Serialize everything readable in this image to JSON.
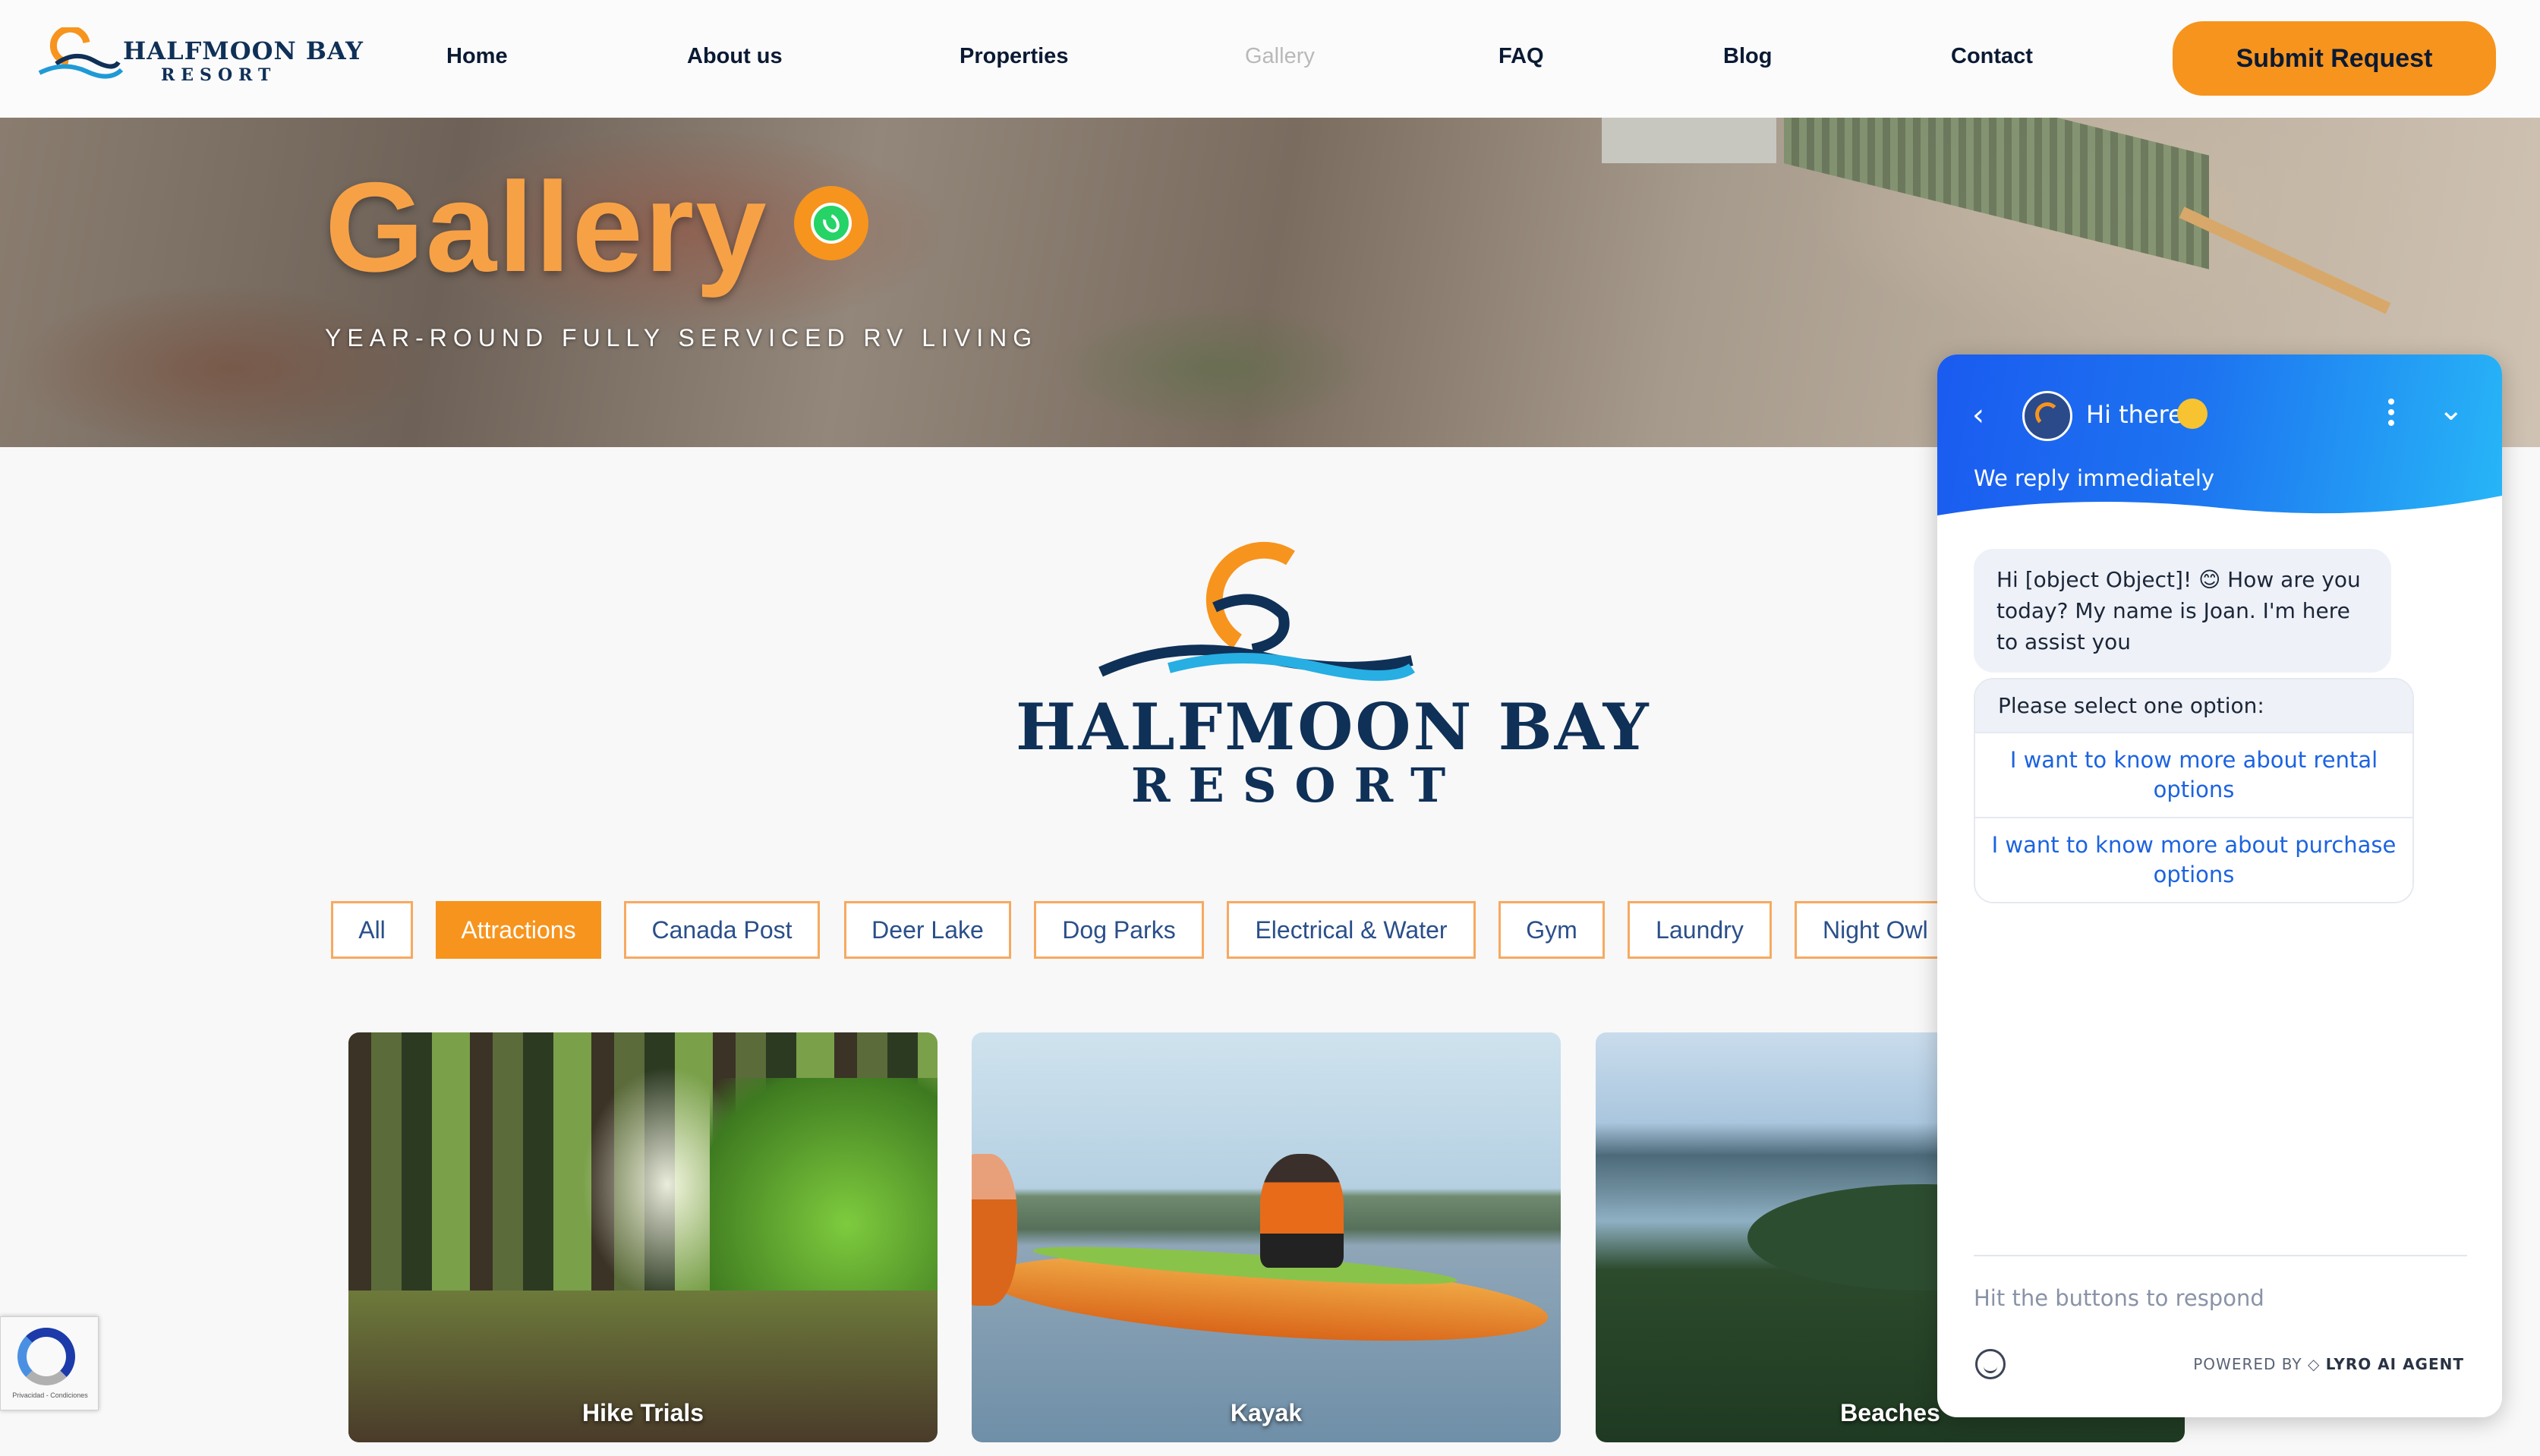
{
  "brand": {
    "name_line1": "HALFMOON BAY",
    "name_line2": "RESORT"
  },
  "nav": {
    "items": [
      "Home",
      "About us",
      "Properties",
      "Gallery",
      "FAQ",
      "Blog",
      "Contact"
    ],
    "active": "Gallery",
    "submit_label": "Submit Request"
  },
  "hero": {
    "title": "Gallery",
    "subtitle": "YEAR-ROUND FULLY SERVICED RV LIVING",
    "icon": "whatsapp-icon"
  },
  "filters": [
    "All",
    "Attractions",
    "Canada Post",
    "Deer Lake",
    "Dog Parks",
    "Electrical & Water",
    "Gym",
    "Laundry",
    "Night Owl"
  ],
  "active_filter": "Attractions",
  "gallery": [
    {
      "caption": "Hike Trials"
    },
    {
      "caption": "Kayak"
    },
    {
      "caption": "Beaches"
    }
  ],
  "recaptcha": {
    "footer": "Privacidad - Condiciones"
  },
  "chat": {
    "title": "Hi there",
    "subtitle": "We reply immediately",
    "message": "Hi [object Object]! 😊 How are you today? My name is Joan. I'm here to assist you",
    "options_header": "Please select one option:",
    "options": [
      "I want to know more about rental options",
      "I want to know more about purchase options"
    ],
    "input_placeholder": "Hit the buttons to respond",
    "powered_prefix": "POWERED BY",
    "powered_brand": "LYRO AI AGENT"
  },
  "colors": {
    "accent": "#f7941d",
    "navy": "#0f3057",
    "chat_blue": "#1c63e0"
  }
}
